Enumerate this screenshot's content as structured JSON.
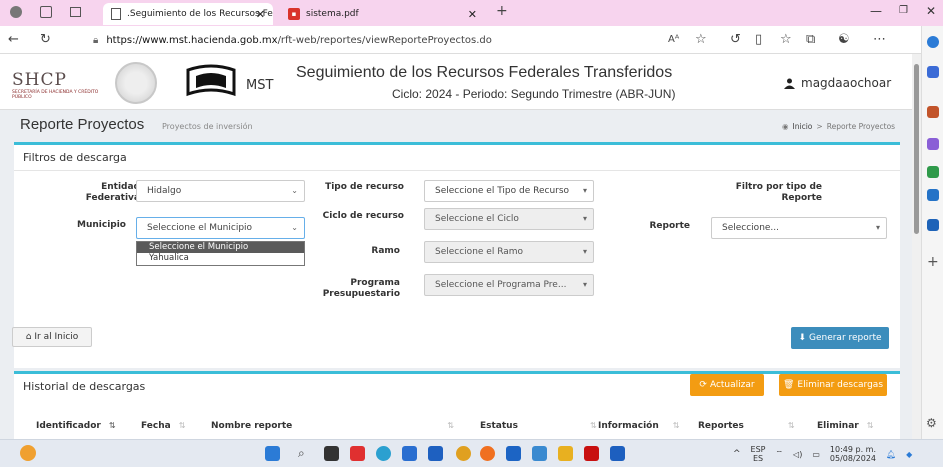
{
  "browser": {
    "tabs": [
      {
        "title": ".Seguimiento de los Recursos Fe"
      },
      {
        "title": "sistema.pdf"
      }
    ],
    "url_domain": "https://www.mst.hacienda.gob.mx",
    "url_path": "/rft-web/reportes/viewReporteProyectos.do"
  },
  "header": {
    "brand": "SHCP",
    "brand_sub": "SECRETARÍA DE HACIENDA Y CRÉDITO PÚBLICO",
    "mst": "MST",
    "title": "Seguimiento de los Recursos Federales Transferidos",
    "subtitle": "Ciclo: 2024 - Periodo: Segundo Trimestre (ABR-JUN)",
    "user": "magdaaochoar"
  },
  "page": {
    "title": "Reporte Proyectos",
    "subtitle": "Proyectos de inversión",
    "breadcrumb": [
      "Inicio",
      ">",
      "Reporte Proyectos"
    ]
  },
  "filters": {
    "panel_title": "Filtros de descarga",
    "entidad_label": "Entidad Federativa",
    "entidad_value": "Hidalgo",
    "municipio_label": "Municipio",
    "municipio_value": "Seleccione el Municipio",
    "municipio_options": [
      "Seleccione el Municipio",
      "Yahualica"
    ],
    "tipo_label": "Tipo de recurso",
    "tipo_value": "Seleccione el Tipo de Recurso",
    "ciclo_label": "Ciclo de recurso",
    "ciclo_value": "Seleccione el Ciclo",
    "ramo_label": "Ramo",
    "ramo_value": "Seleccione el Ramo",
    "programa_label": "Programa Presupuestario",
    "programa_value": "Seleccione el Programa Pre...",
    "filtro_label": "Filtro por tipo de Reporte",
    "reporte_label": "Reporte",
    "reporte_value": "Seleccione...",
    "home_button": "Ir al Inicio",
    "generate_button": "Generar reporte"
  },
  "history": {
    "panel_title": "Historial de descargas",
    "refresh_button": "Actualizar",
    "delete_button": "Eliminar descargas",
    "columns": [
      "Identificador",
      "Fecha",
      "Nombre reporte",
      "Estatus",
      "Información",
      "Reportes",
      "Eliminar"
    ]
  },
  "taskbar": {
    "lang": "ESP",
    "lang_sub": "ES",
    "time": "10:49 p. m.",
    "date": "05/08/2024"
  },
  "colors": {
    "accent": "#3bbdd8",
    "primary_button": "#3c8dbc",
    "warning_button": "#f39c12",
    "tab_bar": "#f7d4ee"
  }
}
